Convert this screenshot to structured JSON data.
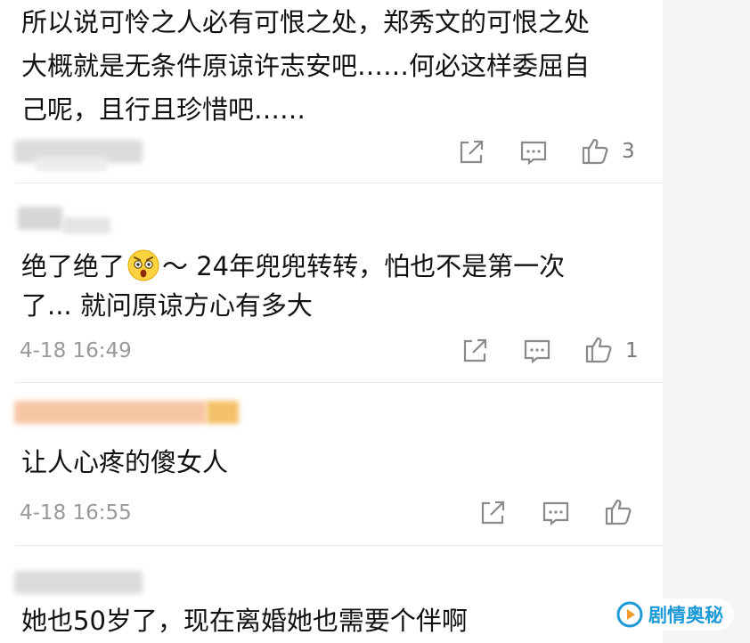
{
  "comments": [
    {
      "author": "",
      "lines": [
        "所以说可怜之人必有可恨之处，郑秀文的可恨之处",
        "大概就是无条件原谅许志安吧……何必这样委屈自",
        "己呢，且行且珍惜吧……"
      ],
      "time": "",
      "likes": "3"
    },
    {
      "author": "",
      "line1_before_emoji": "绝了绝了",
      "emoji": "astonished-face",
      "line1_after_emoji": "～ 24年兜兜转转，怕也不是第一次",
      "line2": "了... 就问原谅方心有多大",
      "time": "4-18 16:49",
      "likes": "1"
    },
    {
      "author": "",
      "lines": [
        "让人心疼的傻女人"
      ],
      "time": "4-18 16:55",
      "likes": ""
    },
    {
      "author": "",
      "lines": [
        "她也50岁了，现在离婚她也需要个伴啊"
      ],
      "time": "",
      "likes": ""
    }
  ],
  "icons": {
    "share": "share-icon",
    "comment": "comment-icon",
    "like": "thumbs-up-icon"
  },
  "watermark": {
    "logo_icon": "play-logo-icon",
    "text": "剧情奥秘",
    "color": "#1e9bd7"
  },
  "colors": {
    "text": "#111111",
    "muted": "#999999",
    "icon": "#8a8a8a",
    "side_panel": "#f4f4f4",
    "blur_orange": "#f7c7a5"
  }
}
